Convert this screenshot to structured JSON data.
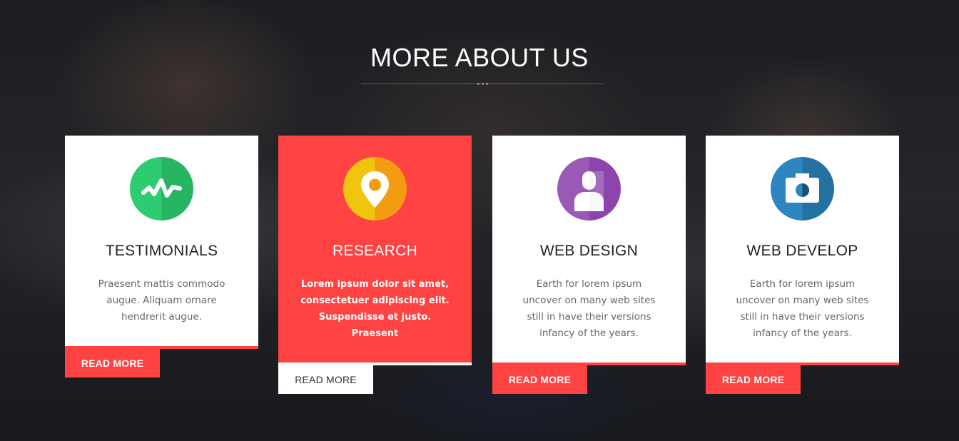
{
  "section": {
    "title": "MORE ABOUT US"
  },
  "colors": {
    "accent": "#ff4242",
    "card_bg": "#ffffff",
    "title_text": "#222222",
    "body_text": "#666666"
  },
  "cards": [
    {
      "icon": "pulse-icon",
      "icon_color": "#2ecc71",
      "title": "TESTIMONIALS",
      "desc_lines": [
        "Praesent mattis commodo",
        "augue. Aliquam ornare",
        "hendrerit augue."
      ],
      "button_label": "READ MORE",
      "active": false
    },
    {
      "icon": "map-pin-icon",
      "icon_color": "#f1c40f",
      "title": "RESEARCH",
      "desc_lines": [
        "Lorem ipsum dolor sit amet,",
        "consectetuer adipiscing elit.",
        "Suspendisse et justo.",
        "Praesent"
      ],
      "button_label": "READ MORE",
      "active": true
    },
    {
      "icon": "user-icon",
      "icon_color": "#9b59b6",
      "title": "WEB DESIGN",
      "desc_lines": [
        "Earth for lorem ipsum",
        "uncover on many web sites",
        "still in have their versions",
        "infancy of the years."
      ],
      "button_label": "READ MORE",
      "active": false
    },
    {
      "icon": "camera-icon",
      "icon_color": "#2e86c1",
      "title": "WEB DEVELOP",
      "desc_lines": [
        "Earth for lorem ipsum",
        "uncover on many web sites",
        "still in have their versions",
        "infancy of the years."
      ],
      "button_label": "READ MORE",
      "active": false
    }
  ]
}
